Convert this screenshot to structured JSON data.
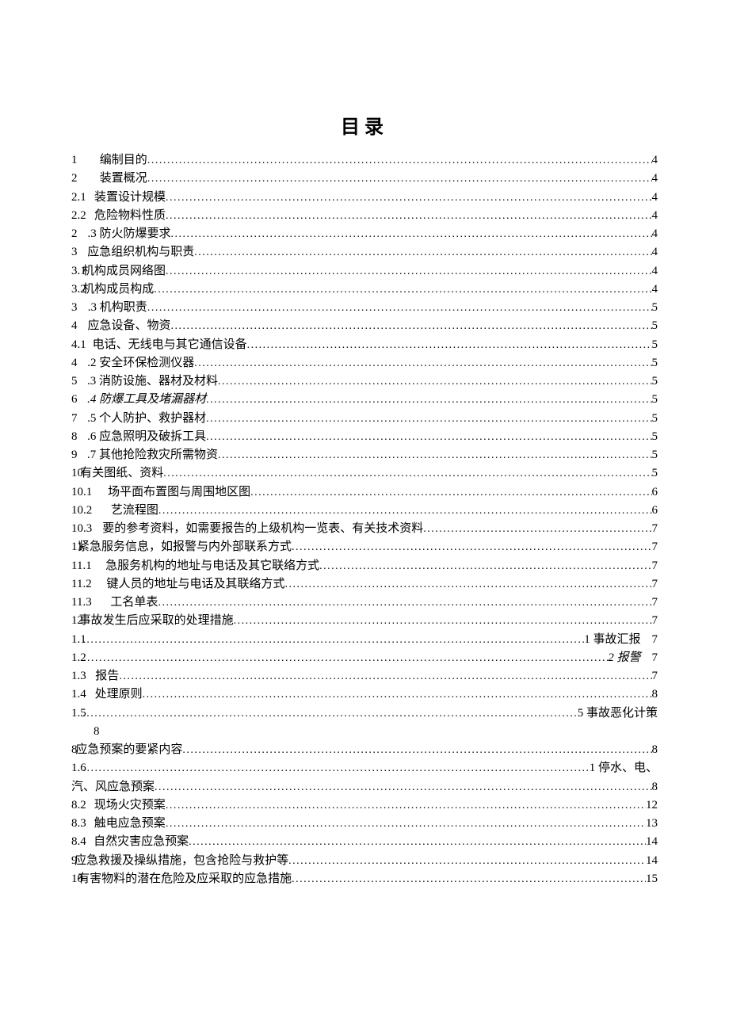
{
  "title": "目录",
  "entries": [
    {
      "num": "1",
      "gap": "　　",
      "label": "编制目的",
      "page": "4"
    },
    {
      "num": "2",
      "gap": "　　",
      "label": "装置概况",
      "page": "4"
    },
    {
      "num": "2.1",
      "gap": "　",
      "label": "装置设计规模 ",
      "page": "4"
    },
    {
      "num": "2.2",
      "gap": "　",
      "label": "危险物料性质 ",
      "page": "4"
    },
    {
      "num": "2",
      "gap": "　",
      "label": ".3 防火防爆要求",
      "page": "4"
    },
    {
      "num": "3",
      "gap": "　",
      "label": "应急组织机构与职责 ",
      "page": "4"
    },
    {
      "num": "3.1 ",
      "gap": "",
      "label": "机构成员网络图 ",
      "page": "4"
    },
    {
      "num": "3.2 ",
      "gap": "",
      "label": "机构成员构成 ",
      "page": "4"
    },
    {
      "num": "3",
      "gap": "　",
      "label": ".3 机构职责",
      "page": "5"
    },
    {
      "num": "4",
      "gap": "　",
      "label": "应急设备、物资",
      "page": "5"
    },
    {
      "num": "4.1",
      "gap": "　",
      "label": "电话、无线电与其它通信设备 ",
      "page": "5"
    },
    {
      "num": "4",
      "gap": "　",
      "label": ".2 安全环保检测仪器",
      "page": "5"
    },
    {
      "num": "5",
      "gap": "　",
      "label": ".3 消防设施、器材及材料",
      "page": "5"
    },
    {
      "num": "6",
      "gap": "　",
      "label": ".4 防爆工具及堵漏器材",
      "page": "5",
      "italicLabel": true
    },
    {
      "num": "7",
      "gap": "　",
      "label": ".5 个人防护、救护器材",
      "page": "5"
    },
    {
      "num": "8",
      "gap": "　",
      "label": ".6 应急照明及破拆工具",
      "page": "5"
    },
    {
      "num": "9",
      "gap": "　",
      "label": ".7 其他抢险救灾所需物资",
      "page": "5"
    },
    {
      "num": "10 ",
      "gap": "",
      "label": "有关图纸、资料",
      "page": "5"
    },
    {
      "num": "10.1",
      "gap": "　　",
      "label": "场平面布置图与周围地区图",
      "page": "6"
    },
    {
      "num": "10.2",
      "gap": "　　",
      "label": "艺流程图",
      "page": "6"
    },
    {
      "num": "10.3",
      "gap": "　　",
      "label": "要的参考资料，如需要报告的上级机构一览表、有关技术资料",
      "page": "7"
    },
    {
      "num": "11 ",
      "gap": "",
      "label": "紧急服务信息，如报警与内外部联系方式",
      "page": "7"
    },
    {
      "num": "11.1",
      "gap": "　　",
      "label": "急服务机构的地址与电话及其它联络方式",
      "page": "7"
    },
    {
      "num": "11.2",
      "gap": "　　",
      "label": "键人员的地址与电话及其联络方式",
      "page": "7"
    },
    {
      "num": "11.3",
      "gap": "　　",
      "label": "工名单表",
      "page": "7"
    },
    {
      "num": "12 ",
      "gap": "",
      "label": "事故发生后应采取的处理措施",
      "page": "7"
    },
    {
      "num": "1.1",
      "gap": " ",
      "label": "",
      "page": "1 事故汇报",
      "tail": "7"
    },
    {
      "num": "1.2",
      "gap": " ",
      "label": "",
      "page": "2 报警",
      "italicPage": true,
      "tail": "7"
    },
    {
      "num": "1.3",
      "gap": "　",
      "label": "报告 ",
      "page": "7"
    },
    {
      "num": "1.4",
      "gap": "　",
      "label": "处理原则 ",
      "page": "8"
    },
    {
      "num": "1.5",
      "gap": " ",
      "label": "",
      "page": "5 事故恶化计策",
      "wrapTail": "8"
    },
    {
      "num": "8 ",
      "gap": "",
      "label": "应急预案的要紧内容",
      "page": "8"
    },
    {
      "num": "1.6",
      "gap": " ",
      "label": "",
      "page": "1 停水、电、"
    },
    {
      "num": "",
      "gap": "",
      "label": "汽、风应急预案",
      "page": "8"
    },
    {
      "num": "8.2",
      "gap": "　",
      "label": "现场火灾预案 ",
      "page": "12"
    },
    {
      "num": "8.3",
      "gap": "　",
      "label": "触电应急预案 ",
      "page": "13"
    },
    {
      "num": "8.4",
      "gap": "　",
      "label": "自然灾害应急预案 ",
      "page": "14"
    },
    {
      "num": "9 ",
      "gap": "",
      "label": "应急救援及操纵措施，包含抢险与救护等 ",
      "page": "14"
    },
    {
      "num": "10 ",
      "gap": "",
      "label": "有害物料的潜在危险及应采取的应急措施",
      "page": "15"
    }
  ]
}
